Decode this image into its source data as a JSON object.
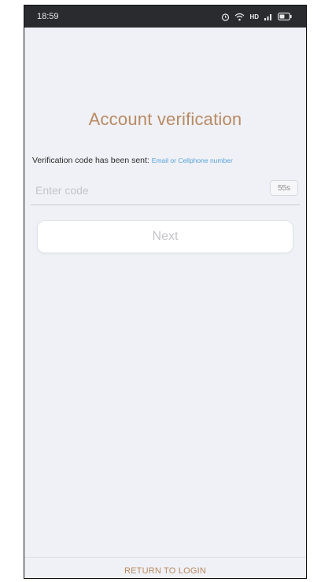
{
  "status_bar": {
    "time": "18:59",
    "network_label": "HD",
    "icons": [
      "alarm-icon",
      "wifi-icon",
      "hd-signal-icon",
      "battery-icon"
    ]
  },
  "page": {
    "title": "Account verification",
    "sent_message": "Verification code has been sent:",
    "sent_destination": "Email or Cellphone number"
  },
  "code_field": {
    "placeholder": "Enter code",
    "value": "",
    "countdown": "55s"
  },
  "next_button": {
    "label": "Next"
  },
  "footer": {
    "return_label": "RETURN TO LOGIN"
  },
  "colors": {
    "accent": "#b98a63",
    "link": "#5aa3d8",
    "background": "#eff1f6",
    "status_bar": "#2a2b2f"
  }
}
